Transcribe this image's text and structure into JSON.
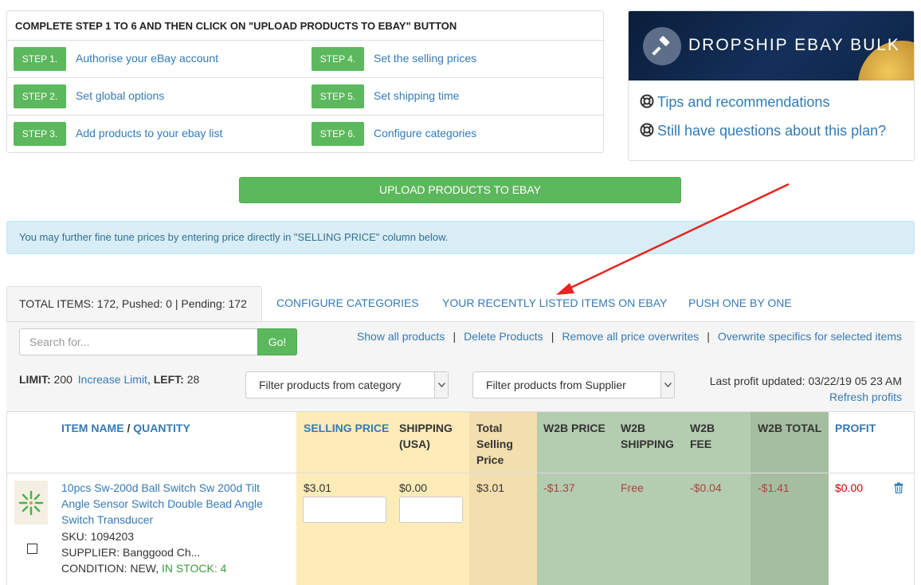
{
  "steps": {
    "title": "COMPLETE STEP 1 TO 6 AND THEN CLICK ON \"UPLOAD PRODUCTS TO EBAY\" BUTTON",
    "items": [
      {
        "badge": "STEP 1.",
        "label": "Authorise your eBay account"
      },
      {
        "badge": "STEP 2.",
        "label": "Set global options"
      },
      {
        "badge": "STEP 3.",
        "label": "Add products to your ebay list"
      },
      {
        "badge": "STEP 4.",
        "label": "Set the selling prices"
      },
      {
        "badge": "STEP 5.",
        "label": "Set shipping time"
      },
      {
        "badge": "STEP 6.",
        "label": "Configure categories"
      }
    ]
  },
  "promo": {
    "title": "DROPSHIP EBAY BULK",
    "links": [
      "Tips and recommendations",
      "Still have questions about this plan?"
    ]
  },
  "upload_button": "UPLOAD PRODUCTS TO EBAY",
  "alert": "You may further fine tune prices by entering price directly in \"SELLING PRICE\" column below.",
  "tabs": {
    "active": "TOTAL ITEMS: 172, Pushed: 0 | Pending: 172",
    "others": [
      "CONFIGURE CATEGORIES",
      "YOUR RECENTLY LISTED ITEMS ON EBAY",
      "PUSH ONE BY ONE"
    ]
  },
  "toolbar": {
    "search_placeholder": "Search for...",
    "go": "Go!",
    "actions": [
      "Show all products",
      "Delete Products",
      "Remove all price overwrites",
      "Overwrite specifics for selected items"
    ],
    "separator": "|",
    "limit_label": "LIMIT:",
    "limit_value": "200",
    "increase_limit": "Increase Limit",
    "comma": ",",
    "left_label": "LEFT:",
    "left_value": "28",
    "filter_category": "Filter products from category",
    "filter_supplier": "Filter products from Supplier",
    "last_profit": "Last profit updated: 03/22/19 05 23 AM",
    "refresh_profits": "Refresh profits"
  },
  "table": {
    "headers": {
      "item_name": "ITEM NAME",
      "slash": "/",
      "quantity": "QUANTITY",
      "selling_price": "SELLING PRICE",
      "shipping": "SHIPPING (USA)",
      "total_selling": "Total Selling Price",
      "w2b_price": "W2B PRICE",
      "w2b_shipping": "W2B SHIPPING",
      "w2b_fee": "W2B FEE",
      "w2b_total": "W2B TOTAL",
      "profit": "PROFIT"
    },
    "colors": {
      "selling_bg": "#fdebb8",
      "total_bg": "#f2deae",
      "w2b_bg": "#b4ccb0",
      "w2b_total_bg": "#a6bea0"
    },
    "rows": [
      {
        "name": "10pcs Sw-200d Ball Switch Sw 200d Tilt Angle Sensor Switch Double Bead Angle Switch Transducer",
        "sku": "SKU: 1094203",
        "supplier": "SUPPLIER: Banggood Ch...",
        "condition": "CONDITION: NEW,",
        "stock": "IN STOCK: 4",
        "selling_price": "$3.01",
        "shipping": "$0.00",
        "total": "$3.01",
        "w2b_price": "-$1.37",
        "w2b_shipping": "Free",
        "w2b_fee": "-$0.04",
        "w2b_total": "-$1.41",
        "profit": "$0.00"
      }
    ]
  }
}
